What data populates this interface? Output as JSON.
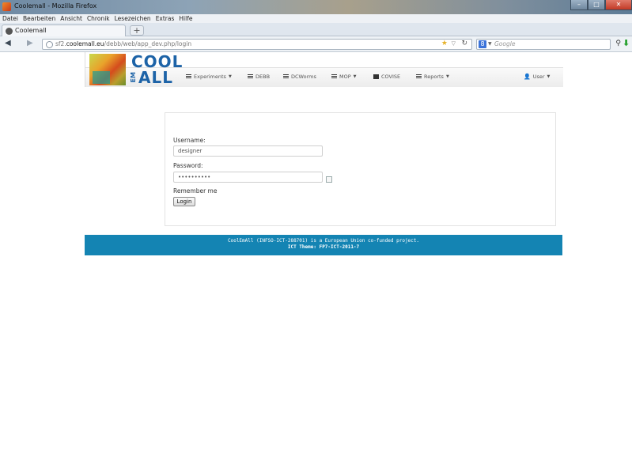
{
  "window": {
    "title": "Coolemall - Mozilla Firefox"
  },
  "menubar": [
    "Datei",
    "Bearbeiten",
    "Ansicht",
    "Chronik",
    "Lesezeichen",
    "Extras",
    "Hilfe"
  ],
  "tab": {
    "label": "Coolemall"
  },
  "url": {
    "prefix": "sf2.",
    "domain": "coolemall.eu",
    "path": "/debb/web/app_dev.php/login"
  },
  "search": {
    "placeholder": "Google"
  },
  "logo": {
    "line1": "COOL",
    "em": "EM",
    "line2": "ALL"
  },
  "nav": [
    {
      "label": "Experiments",
      "dropdown": true,
      "icon": "list-icon"
    },
    {
      "label": "DEBB",
      "dropdown": false,
      "icon": "list-icon"
    },
    {
      "label": "DCWorms",
      "dropdown": false,
      "icon": "list-icon"
    },
    {
      "label": "MOP",
      "dropdown": true,
      "icon": "list-icon"
    },
    {
      "label": "COVISE",
      "dropdown": false,
      "icon": "hdd-icon"
    },
    {
      "label": "Reports",
      "dropdown": true,
      "icon": "list-icon"
    }
  ],
  "user_menu": {
    "label": "User"
  },
  "login": {
    "username_label": "Username:",
    "username_value": "designer",
    "password_label": "Password:",
    "password_value": "••••••••••",
    "remember_label": "Remember me",
    "submit_label": "Login"
  },
  "footer": {
    "line1": "CoolEmAll (INFSO-ICT-288701) is a European Union co-funded project.",
    "line2": "ICT Theme: FP7-ICT-2011-7"
  }
}
